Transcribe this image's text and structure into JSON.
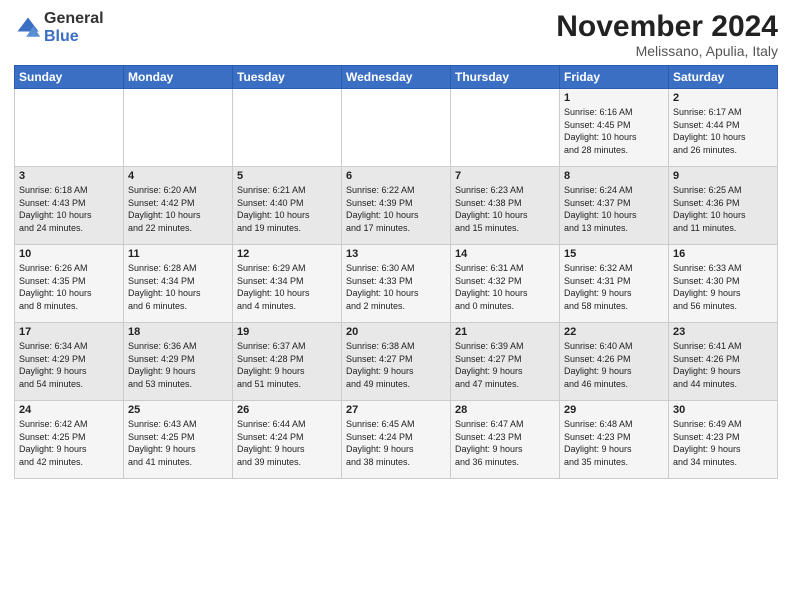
{
  "header": {
    "logo_general": "General",
    "logo_blue": "Blue",
    "month_title": "November 2024",
    "location": "Melissano, Apulia, Italy"
  },
  "weekdays": [
    "Sunday",
    "Monday",
    "Tuesday",
    "Wednesday",
    "Thursday",
    "Friday",
    "Saturday"
  ],
  "weeks": [
    [
      {
        "day": "",
        "info": ""
      },
      {
        "day": "",
        "info": ""
      },
      {
        "day": "",
        "info": ""
      },
      {
        "day": "",
        "info": ""
      },
      {
        "day": "",
        "info": ""
      },
      {
        "day": "1",
        "info": "Sunrise: 6:16 AM\nSunset: 4:45 PM\nDaylight: 10 hours\nand 28 minutes."
      },
      {
        "day": "2",
        "info": "Sunrise: 6:17 AM\nSunset: 4:44 PM\nDaylight: 10 hours\nand 26 minutes."
      }
    ],
    [
      {
        "day": "3",
        "info": "Sunrise: 6:18 AM\nSunset: 4:43 PM\nDaylight: 10 hours\nand 24 minutes."
      },
      {
        "day": "4",
        "info": "Sunrise: 6:20 AM\nSunset: 4:42 PM\nDaylight: 10 hours\nand 22 minutes."
      },
      {
        "day": "5",
        "info": "Sunrise: 6:21 AM\nSunset: 4:40 PM\nDaylight: 10 hours\nand 19 minutes."
      },
      {
        "day": "6",
        "info": "Sunrise: 6:22 AM\nSunset: 4:39 PM\nDaylight: 10 hours\nand 17 minutes."
      },
      {
        "day": "7",
        "info": "Sunrise: 6:23 AM\nSunset: 4:38 PM\nDaylight: 10 hours\nand 15 minutes."
      },
      {
        "day": "8",
        "info": "Sunrise: 6:24 AM\nSunset: 4:37 PM\nDaylight: 10 hours\nand 13 minutes."
      },
      {
        "day": "9",
        "info": "Sunrise: 6:25 AM\nSunset: 4:36 PM\nDaylight: 10 hours\nand 11 minutes."
      }
    ],
    [
      {
        "day": "10",
        "info": "Sunrise: 6:26 AM\nSunset: 4:35 PM\nDaylight: 10 hours\nand 8 minutes."
      },
      {
        "day": "11",
        "info": "Sunrise: 6:28 AM\nSunset: 4:34 PM\nDaylight: 10 hours\nand 6 minutes."
      },
      {
        "day": "12",
        "info": "Sunrise: 6:29 AM\nSunset: 4:34 PM\nDaylight: 10 hours\nand 4 minutes."
      },
      {
        "day": "13",
        "info": "Sunrise: 6:30 AM\nSunset: 4:33 PM\nDaylight: 10 hours\nand 2 minutes."
      },
      {
        "day": "14",
        "info": "Sunrise: 6:31 AM\nSunset: 4:32 PM\nDaylight: 10 hours\nand 0 minutes."
      },
      {
        "day": "15",
        "info": "Sunrise: 6:32 AM\nSunset: 4:31 PM\nDaylight: 9 hours\nand 58 minutes."
      },
      {
        "day": "16",
        "info": "Sunrise: 6:33 AM\nSunset: 4:30 PM\nDaylight: 9 hours\nand 56 minutes."
      }
    ],
    [
      {
        "day": "17",
        "info": "Sunrise: 6:34 AM\nSunset: 4:29 PM\nDaylight: 9 hours\nand 54 minutes."
      },
      {
        "day": "18",
        "info": "Sunrise: 6:36 AM\nSunset: 4:29 PM\nDaylight: 9 hours\nand 53 minutes."
      },
      {
        "day": "19",
        "info": "Sunrise: 6:37 AM\nSunset: 4:28 PM\nDaylight: 9 hours\nand 51 minutes."
      },
      {
        "day": "20",
        "info": "Sunrise: 6:38 AM\nSunset: 4:27 PM\nDaylight: 9 hours\nand 49 minutes."
      },
      {
        "day": "21",
        "info": "Sunrise: 6:39 AM\nSunset: 4:27 PM\nDaylight: 9 hours\nand 47 minutes."
      },
      {
        "day": "22",
        "info": "Sunrise: 6:40 AM\nSunset: 4:26 PM\nDaylight: 9 hours\nand 46 minutes."
      },
      {
        "day": "23",
        "info": "Sunrise: 6:41 AM\nSunset: 4:26 PM\nDaylight: 9 hours\nand 44 minutes."
      }
    ],
    [
      {
        "day": "24",
        "info": "Sunrise: 6:42 AM\nSunset: 4:25 PM\nDaylight: 9 hours\nand 42 minutes."
      },
      {
        "day": "25",
        "info": "Sunrise: 6:43 AM\nSunset: 4:25 PM\nDaylight: 9 hours\nand 41 minutes."
      },
      {
        "day": "26",
        "info": "Sunrise: 6:44 AM\nSunset: 4:24 PM\nDaylight: 9 hours\nand 39 minutes."
      },
      {
        "day": "27",
        "info": "Sunrise: 6:45 AM\nSunset: 4:24 PM\nDaylight: 9 hours\nand 38 minutes."
      },
      {
        "day": "28",
        "info": "Sunrise: 6:47 AM\nSunset: 4:23 PM\nDaylight: 9 hours\nand 36 minutes."
      },
      {
        "day": "29",
        "info": "Sunrise: 6:48 AM\nSunset: 4:23 PM\nDaylight: 9 hours\nand 35 minutes."
      },
      {
        "day": "30",
        "info": "Sunrise: 6:49 AM\nSunset: 4:23 PM\nDaylight: 9 hours\nand 34 minutes."
      }
    ]
  ]
}
